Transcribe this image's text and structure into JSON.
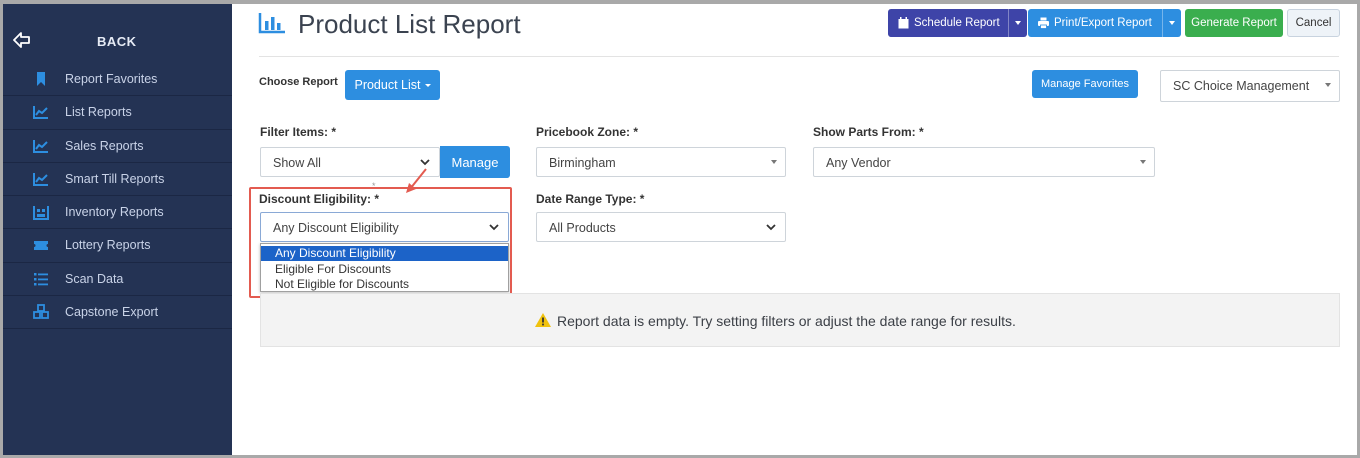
{
  "sidebar": {
    "back_label": "BACK",
    "items": [
      {
        "label": "Report Favorites",
        "icon": "bookmark-icon"
      },
      {
        "label": "List Reports",
        "icon": "line-chart-icon"
      },
      {
        "label": "Sales Reports",
        "icon": "line-chart-icon"
      },
      {
        "label": "Smart Till Reports",
        "icon": "line-chart-icon"
      },
      {
        "label": "Inventory Reports",
        "icon": "warehouse-icon"
      },
      {
        "label": "Lottery Reports",
        "icon": "ticket-icon"
      },
      {
        "label": "Scan Data",
        "icon": "list-icon"
      },
      {
        "label": "Capstone Export",
        "icon": "cubes-icon"
      }
    ]
  },
  "header": {
    "title": "Product List Report",
    "schedule_label": "Schedule Report",
    "print_label": "Print/Export Report",
    "generate_label": "Generate Report",
    "cancel_label": "Cancel"
  },
  "report_bar": {
    "choose_label": "Choose Report",
    "report_button": "Product List",
    "manage_favorites": "Manage Favorites",
    "company_value": "SC Choice Management"
  },
  "filters": {
    "filter_items_label": "Filter Items: *",
    "filter_items_value": "Show All",
    "manage_label": "Manage",
    "pricebook_label": "Pricebook Zone: *",
    "pricebook_value": "Birmingham",
    "parts_label": "Show Parts From: *",
    "parts_value": "Any Vendor",
    "discount_label": "Discount Eligibility: *",
    "discount_value": "Any Discount Eligibility",
    "discount_options": [
      "Any Discount Eligibility",
      "Eligible For Discounts",
      "Not Eligible for Discounts"
    ],
    "range_label": "Date Range Type: *",
    "range_value": "All Products",
    "annotation_asterisk": "*"
  },
  "notice": {
    "text": "Report data is empty. Try setting filters or adjust the date range for results."
  },
  "colors": {
    "sidebar_bg": "#243354",
    "primary": "#2d8ee0",
    "schedule": "#3e44a8",
    "generate": "#3aae4e",
    "highlight": "#e35b50",
    "warning": "#f0c20e"
  }
}
